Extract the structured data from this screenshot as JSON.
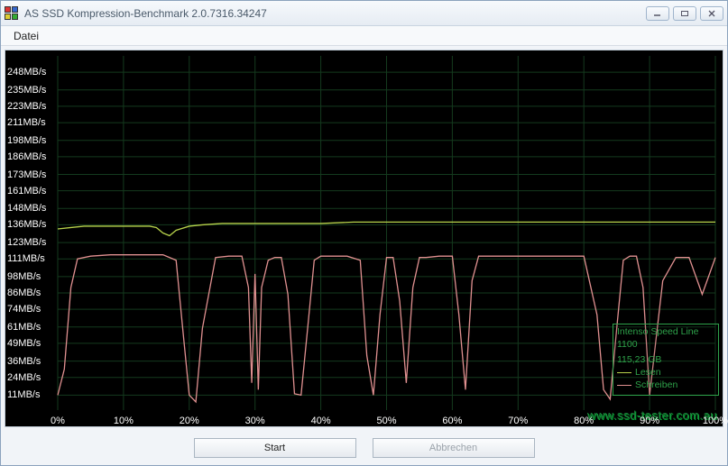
{
  "window": {
    "title": "AS SSD Kompression-Benchmark 2.0.7316.34247"
  },
  "menubar": {
    "file": "Datei"
  },
  "buttons": {
    "start": "Start",
    "abort": "Abbrechen"
  },
  "legend": {
    "device": "Intenso Speed Line 1100",
    "capacity": "115,23 GB",
    "read": "Lesen",
    "write": "Schreiben",
    "read_color": "#b7d24b",
    "write_color": "#e09090"
  },
  "watermark": "www.ssd-tester.com.au",
  "chart_data": {
    "type": "line",
    "title": "",
    "xlabel": "",
    "ylabel": "",
    "xlim": [
      0,
      100
    ],
    "ylim": [
      0,
      260
    ],
    "x_ticks": [
      "0%",
      "10%",
      "20%",
      "30%",
      "40%",
      "50%",
      "60%",
      "70%",
      "80%",
      "90%",
      "100%"
    ],
    "y_ticks": [
      "11MB/s",
      "24MB/s",
      "36MB/s",
      "49MB/s",
      "61MB/s",
      "74MB/s",
      "86MB/s",
      "98MB/s",
      "111MB/s",
      "123MB/s",
      "136MB/s",
      "148MB/s",
      "161MB/s",
      "173MB/s",
      "186MB/s",
      "198MB/s",
      "211MB/s",
      "223MB/s",
      "235MB/s",
      "248MB/s"
    ],
    "y_tick_values": [
      11,
      24,
      36,
      49,
      61,
      74,
      86,
      98,
      111,
      123,
      136,
      148,
      161,
      173,
      186,
      198,
      211,
      223,
      235,
      248
    ],
    "grid": true,
    "series": [
      {
        "name": "Lesen",
        "color": "#b7d24b",
        "x": [
          0,
          2,
          4,
          6,
          8,
          10,
          12,
          14,
          15,
          16,
          17,
          18,
          20,
          22,
          25,
          30,
          35,
          40,
          45,
          50,
          55,
          60,
          65,
          70,
          75,
          80,
          85,
          90,
          95,
          100
        ],
        "values": [
          133,
          134,
          135,
          135,
          135,
          135,
          135,
          135,
          134,
          130,
          128,
          132,
          135,
          136,
          137,
          137,
          137,
          137,
          138,
          138,
          138,
          138,
          138,
          138,
          138,
          138,
          138,
          138,
          138,
          138
        ]
      },
      {
        "name": "Schreiben",
        "color": "#e09090",
        "x": [
          0,
          1,
          2,
          3,
          5,
          8,
          12,
          16,
          18,
          19,
          20,
          21,
          22,
          24,
          26,
          28,
          29,
          29.5,
          30,
          30.5,
          31,
          32,
          33,
          34,
          35,
          36,
          37,
          38,
          39,
          40,
          41,
          42,
          44,
          46,
          47,
          48,
          49,
          50,
          51,
          52,
          53,
          54,
          55,
          56,
          58,
          60,
          61,
          62,
          63,
          64,
          66,
          68,
          70,
          72,
          74,
          76,
          78,
          80,
          82,
          83,
          84,
          85,
          86,
          87,
          88,
          89,
          90,
          92,
          94,
          96,
          98,
          100
        ],
        "values": [
          11,
          30,
          90,
          111,
          113,
          114,
          114,
          114,
          110,
          60,
          11,
          6,
          60,
          112,
          113,
          113,
          90,
          20,
          100,
          15,
          90,
          110,
          112,
          112,
          85,
          12,
          11,
          60,
          110,
          113,
          113,
          113,
          113,
          110,
          40,
          11,
          70,
          112,
          112,
          80,
          20,
          90,
          112,
          112,
          113,
          113,
          70,
          15,
          95,
          113,
          113,
          113,
          113,
          113,
          113,
          113,
          113,
          113,
          70,
          15,
          8,
          60,
          110,
          113,
          113,
          90,
          11,
          95,
          112,
          112,
          85,
          112
        ]
      }
    ]
  }
}
